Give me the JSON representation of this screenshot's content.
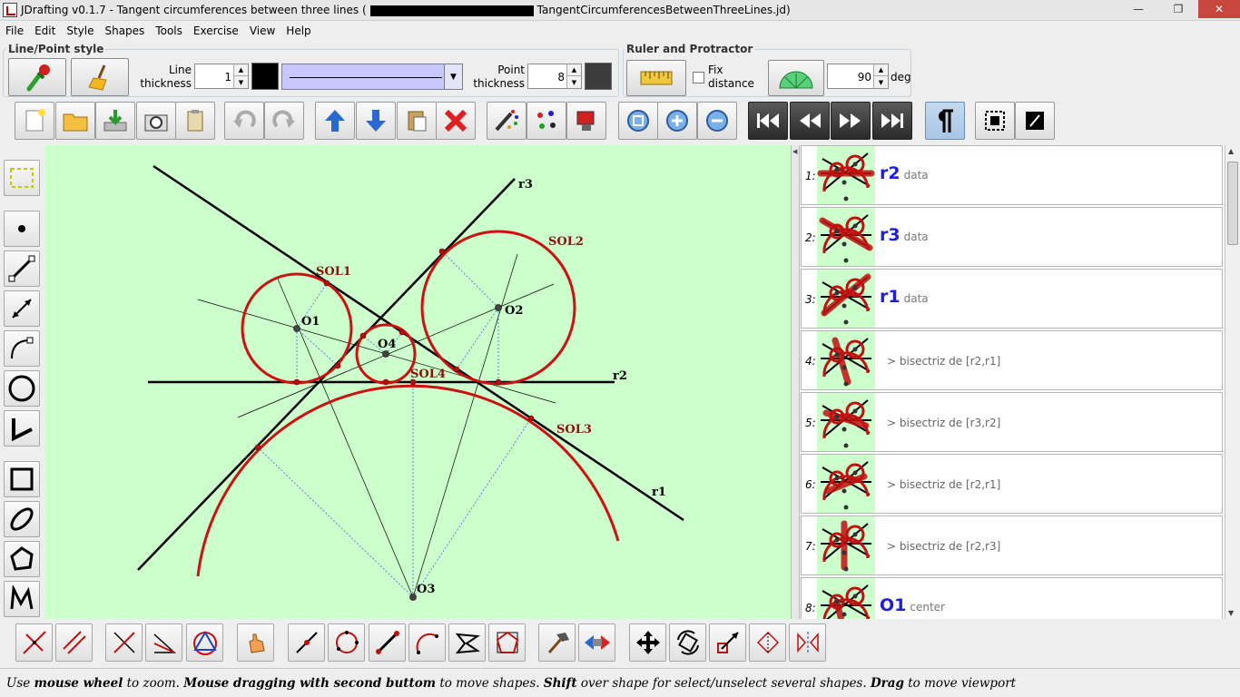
{
  "window": {
    "title_prefix": "JDrafting   v0.1.7 - Tangent circumferences between three lines (",
    "title_suffix": "TangentCircumferencesBetweenThreeLines.jd)",
    "min_glyph": "—",
    "max_glyph": "❐",
    "close_glyph": "✕"
  },
  "menu": [
    "File",
    "Edit",
    "Style",
    "Shapes",
    "Tools",
    "Exercise",
    "View",
    "Help"
  ],
  "line_point_style": {
    "title": "Line/Point style",
    "line_thickness_label_1": "Line",
    "line_thickness_label_2": "thickness",
    "line_thickness_value": "1",
    "line_color": "#000000",
    "point_thickness_label_1": "Point",
    "point_thickness_label_2": "thickness",
    "point_thickness_value": "8",
    "point_color": "#3c3c3c",
    "line_style_bg": "#c8c8ff"
  },
  "ruler": {
    "title": "Ruler and Protractor",
    "fix_label_1": "Fix",
    "fix_label_2": "distance",
    "angle_value": "90",
    "angle_unit": "deg"
  },
  "canvas": {
    "bg": "#ccffcc",
    "labels": {
      "r1": "r1",
      "r2": "r2",
      "r3": "r3",
      "O1": "O1",
      "O2": "O2",
      "O3": "O3",
      "O4": "O4",
      "SOL1": "SOL1",
      "SOL2": "SOL2",
      "SOL3": "SOL3",
      "SOL4": "SOL4"
    }
  },
  "shapes": [
    {
      "num": "1:",
      "name": "r2",
      "kind": "data",
      "desc": ""
    },
    {
      "num": "2:",
      "name": "r3",
      "kind": "data",
      "desc": ""
    },
    {
      "num": "3:",
      "name": "r1",
      "kind": "data",
      "desc": ""
    },
    {
      "num": "4:",
      "name": "",
      "kind": "",
      "desc": "> bisectriz de [r2,r1]"
    },
    {
      "num": "5:",
      "name": "",
      "kind": "",
      "desc": "> bisectriz de [r3,r2]"
    },
    {
      "num": "6:",
      "name": "",
      "kind": "",
      "desc": "> bisectriz de [r2,r1]"
    },
    {
      "num": "7:",
      "name": "",
      "kind": "",
      "desc": "> bisectriz de [r2,r3]"
    },
    {
      "num": "8:",
      "name": "O1",
      "kind": "center",
      "desc": ""
    }
  ],
  "status": {
    "p1": "Use ",
    "b1": "mouse wheel",
    "p2": " to zoom. ",
    "b2": "Mouse dragging with second buttom",
    "p3": " to move shapes. ",
    "b3": "Shift",
    "p4": " over shape for select/unselect several shapes. ",
    "b4": "Drag",
    "p5": " to move viewport"
  }
}
